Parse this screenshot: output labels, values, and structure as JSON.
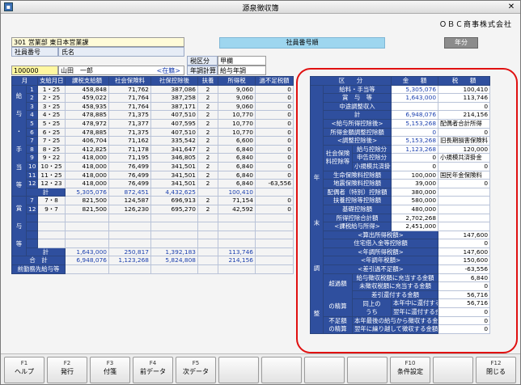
{
  "window": {
    "title": "源泉徴収簿",
    "company": "ＯＢＣ商事株式会社"
  },
  "employee": {
    "dept": "301 営業部 東日本営業課",
    "no_label": "社員番号",
    "name_label": "氏名",
    "no": "100000",
    "name": "山田　一郎",
    "status": "<在籍>",
    "tax_label": "税区分",
    "tax": "甲欄",
    "adj_label": "年調計算",
    "adj": "給与年調",
    "id_label": "社員番号順",
    "year_btn": "年分"
  },
  "left": {
    "headers": [
      "月",
      "支給月日",
      "課税支給額",
      "社会保険料",
      "社保控除後",
      "扶養",
      "所得税",
      "過不足税額"
    ],
    "salary_label": [
      "給",
      "与",
      "・",
      "手",
      "当",
      "等"
    ],
    "salary": [
      [
        "1",
        "1・25",
        "458,848",
        "71,762",
        "387,086",
        "2",
        "9,060",
        "0"
      ],
      [
        "2",
        "2・25",
        "459,022",
        "71,764",
        "387,258",
        "2",
        "9,060",
        "0"
      ],
      [
        "3",
        "3・25",
        "458,935",
        "71,764",
        "387,171",
        "2",
        "9,060",
        "0"
      ],
      [
        "4",
        "4・25",
        "478,885",
        "71,375",
        "407,510",
        "2",
        "10,770",
        "0"
      ],
      [
        "5",
        "5・25",
        "478,972",
        "71,377",
        "407,595",
        "2",
        "10,770",
        "0"
      ],
      [
        "6",
        "6・25",
        "478,885",
        "71,375",
        "407,510",
        "2",
        "10,770",
        "0"
      ],
      [
        "7",
        "7・25",
        "406,704",
        "71,162",
        "335,542",
        "2",
        "6,600",
        "0"
      ],
      [
        "8",
        "8・25",
        "412,825",
        "71,178",
        "341,647",
        "2",
        "6,840",
        "0"
      ],
      [
        "9",
        "9・22",
        "418,000",
        "71,195",
        "346,805",
        "2",
        "6,840",
        "0"
      ],
      [
        "10",
        "10・25",
        "418,000",
        "76,499",
        "341,501",
        "2",
        "6,840",
        "0"
      ],
      [
        "11",
        "11・25",
        "418,000",
        "76,499",
        "341,501",
        "2",
        "6,840",
        "0"
      ],
      [
        "12",
        "12・23",
        "418,000",
        "76,499",
        "341,501",
        "2",
        "6,840",
        "-63,556"
      ]
    ],
    "salary_total": [
      "計",
      "5,305,076",
      "872,451",
      "4,432,625",
      "",
      "100,410",
      ""
    ],
    "bonus_label": [
      "賞",
      "与",
      "等"
    ],
    "bonus": [
      [
        "7",
        "7・8",
        "821,500",
        "124,587",
        "696,913",
        "2",
        "71,154",
        "0"
      ],
      [
        "12",
        "9・7",
        "821,500",
        "126,230",
        "695,270",
        "2",
        "42,592",
        "0"
      ]
    ],
    "bonus_total": [
      "計",
      "1,643,000",
      "250,817",
      "1,392,183",
      "",
      "113,746",
      ""
    ],
    "grand_total": [
      "合　計",
      "6,948,076",
      "1,123,268",
      "5,824,808",
      "",
      "214,156",
      ""
    ],
    "prev": "前勤務先給与等"
  },
  "right": {
    "headers": [
      "区　　分",
      "金　　額",
      "税　　額"
    ],
    "nen": "年",
    "matsu": "末",
    "chou": "調",
    "sei": "整",
    "rows": [
      {
        "l": "給料・手当等",
        "a": "5,305,076",
        "t": "100,410"
      },
      {
        "l": "賞　与　等",
        "a": "1,643,000",
        "t": "113,746"
      },
      {
        "l": "中途調整収入",
        "a": "",
        "t": "0"
      },
      {
        "l": "計",
        "a": "6,948,076",
        "t": "214,156"
      },
      {
        "l": "<給与所得控除後>",
        "a": "5,153,268",
        "t": "配偶者合計所得"
      },
      {
        "l": "所得金額調整控除額",
        "a": "0",
        "t": "0"
      },
      {
        "l": "<調整控除後>",
        "a": "5,153,268",
        "t": "旧長期損害保険料"
      }
    ],
    "social_label": "社会保険料控除等",
    "social": [
      {
        "l": "給与控除分",
        "a": "1,123,268",
        "t": "120,000"
      },
      {
        "l": "申告控除分",
        "a": "0",
        "t": "小規模共済掛金"
      },
      {
        "l": "小規模共済掛金",
        "a": "0",
        "t": "0"
      }
    ],
    "rows2": [
      {
        "l": "生命保険料控除額",
        "a": "100,000",
        "t": "国民年金保険料"
      },
      {
        "l": "地震保険料控除額",
        "a": "39,000",
        "t": "0"
      },
      {
        "l": "配偶者（特別）控除額",
        "a": "380,000",
        "t": ""
      },
      {
        "l": "扶養控除等控除額",
        "a": "580,000",
        "t": ""
      },
      {
        "l": "基礎控除額",
        "a": "480,000",
        "t": ""
      },
      {
        "l": "所得控除合計額",
        "a": "2,702,268",
        "t": ""
      },
      {
        "l": "<課税給与所得>",
        "a": "2,451,000",
        "t": ""
      }
    ],
    "rows3": [
      {
        "l": "<算出所得税額>",
        "t": "147,600"
      },
      {
        "l": "住宅借入金等控除額",
        "t": "0"
      },
      {
        "l": "<年調所得税額>",
        "t": "147,600"
      },
      {
        "l": "<年調年税額>",
        "t": "150,600"
      },
      {
        "l": "<差引過不足額>",
        "t": "-63,556"
      }
    ],
    "over_label": "超過額",
    "over": [
      {
        "l": "給与徴収税額に充当する金額",
        "t": "6,840"
      },
      {
        "l": "未徴収税額に充当する金額",
        "t": "0"
      },
      {
        "l": "差引還付する金額",
        "t": "56,716"
      }
    ],
    "accurate_label": "の精算",
    "same_label": "同上の",
    "uchi": "うち",
    "same": [
      {
        "l": "本年中に還付する金額",
        "t": "56,716"
      },
      {
        "l": "翌年に還付する金額",
        "t": "0"
      }
    ],
    "short_label": "不足額",
    "short_label2": "の精算",
    "short": [
      {
        "l": "本年最後の給与から徴収する金額",
        "t": "0"
      },
      {
        "l": "翌年に繰り越して徴収する金額",
        "t": "0"
      }
    ]
  },
  "fkeys": [
    {
      "k": "F1",
      "n": "ヘルプ"
    },
    {
      "k": "F2",
      "n": "発行"
    },
    {
      "k": "F3",
      "n": "付箋"
    },
    {
      "k": "F4",
      "n": "前データ"
    },
    {
      "k": "F5",
      "n": "次データ"
    },
    {
      "k": "",
      "n": ""
    },
    {
      "k": "",
      "n": ""
    },
    {
      "k": "",
      "n": ""
    },
    {
      "k": "",
      "n": ""
    },
    {
      "k": "F10",
      "n": "条件設定"
    },
    {
      "k": "",
      "n": ""
    },
    {
      "k": "F12",
      "n": "閉じる"
    }
  ]
}
